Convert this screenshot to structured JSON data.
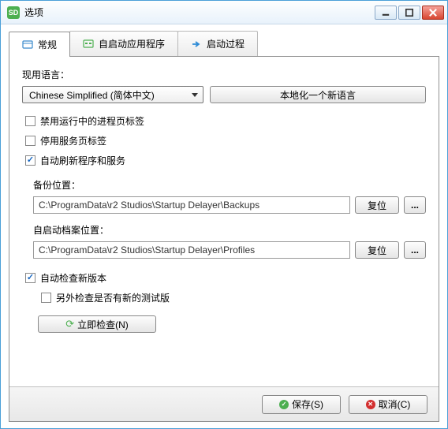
{
  "window": {
    "title": "选项",
    "icon_label": "SD"
  },
  "tabs": [
    {
      "label": "常规"
    },
    {
      "label": "自启动应用程序"
    },
    {
      "label": "启动过程"
    }
  ],
  "language": {
    "label": "现用语言：",
    "selected": "Chinese Simplified (简体中文)",
    "localize_btn": "本地化一个新语言"
  },
  "checks": {
    "disable_running_tab": "禁用运行中的进程页标签",
    "stop_service_tab": "停用服务页标签",
    "auto_refresh": "自动刷新程序和服务"
  },
  "backup": {
    "label": "备份位置：",
    "path": "C:\\ProgramData\\r2 Studios\\Startup Delayer\\Backups",
    "reset": "复位",
    "browse": "..."
  },
  "profile": {
    "label": "自启动档案位置：",
    "path": "C:\\ProgramData\\r2 Studios\\Startup Delayer\\Profiles",
    "reset": "复位",
    "browse": "..."
  },
  "update": {
    "auto_check": "自动检查新版本",
    "beta_check": "另外检查是否有新的测试版",
    "check_now": "立即检查(N)"
  },
  "footer": {
    "save": "保存(S)",
    "cancel": "取消(C)"
  }
}
